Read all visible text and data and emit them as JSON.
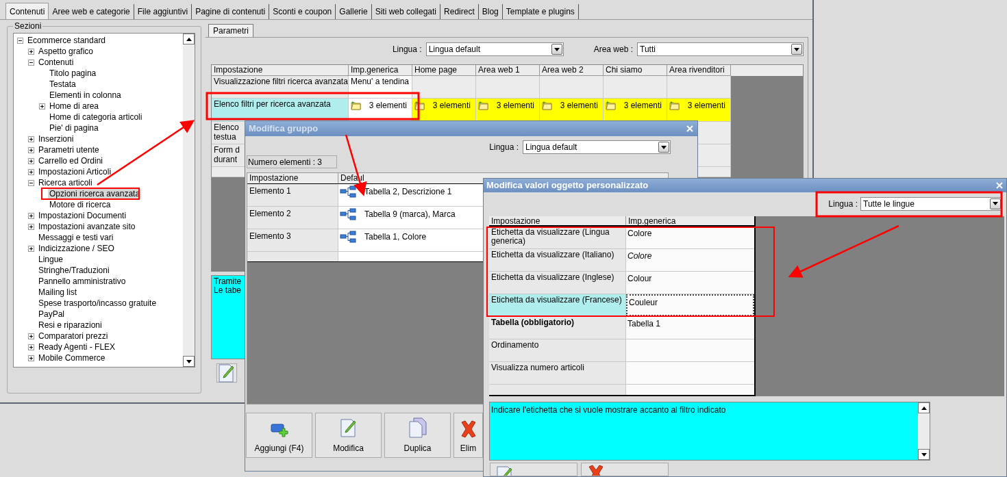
{
  "tabs": [
    {
      "label": "Contenuti",
      "selected": true
    },
    {
      "label": "Aree web e categorie",
      "selected": false
    },
    {
      "label": "File aggiuntivi",
      "selected": false
    },
    {
      "label": "Pagine di contenuti",
      "selected": false
    },
    {
      "label": "Sconti e coupon",
      "selected": false
    },
    {
      "label": "Gallerie",
      "selected": false
    },
    {
      "label": "Siti web collegati",
      "selected": false
    },
    {
      "label": "Redirect",
      "selected": false
    },
    {
      "label": "Blog",
      "selected": false
    },
    {
      "label": "Template e plugins",
      "selected": false
    }
  ],
  "sections": {
    "title": "Sezioni",
    "tree": [
      {
        "label": "Ecommerce standard",
        "kind": "group",
        "expanded": true,
        "selected": false,
        "children": [
          {
            "label": "Aspetto grafico",
            "kind": "group",
            "expanded": false,
            "selected": false
          },
          {
            "label": "Contenuti",
            "kind": "group",
            "expanded": true,
            "selected": false,
            "children": [
              {
                "label": "Titolo pagina",
                "kind": "leaf",
                "selected": false
              },
              {
                "label": "Testata",
                "kind": "leaf",
                "selected": false
              },
              {
                "label": "Elementi in colonna",
                "kind": "leaf",
                "selected": false
              },
              {
                "label": "Home di area",
                "kind": "group",
                "expanded": false,
                "selected": false
              },
              {
                "label": "Home di categoria articoli",
                "kind": "leaf",
                "selected": false
              },
              {
                "label": "Pie' di pagina",
                "kind": "leaf",
                "selected": false
              }
            ]
          },
          {
            "label": "Inserzioni",
            "kind": "group",
            "expanded": false,
            "selected": false
          },
          {
            "label": "Parametri utente",
            "kind": "group",
            "expanded": false,
            "selected": false
          },
          {
            "label": "Carrello ed Ordini",
            "kind": "group",
            "expanded": false,
            "selected": false
          },
          {
            "label": "Impostazioni Articoli",
            "kind": "group",
            "expanded": false,
            "selected": false
          },
          {
            "label": "Ricerca articoli",
            "kind": "group",
            "expanded": true,
            "selected": false,
            "children": [
              {
                "label": "Opzioni ricerca avanzata",
                "kind": "leaf",
                "selected": true
              },
              {
                "label": "Motore di ricerca",
                "kind": "leaf",
                "selected": false
              }
            ]
          },
          {
            "label": "Impostazioni Documenti",
            "kind": "group",
            "expanded": false,
            "selected": false
          },
          {
            "label": "Impostazioni avanzate sito",
            "kind": "group",
            "expanded": false,
            "selected": false
          },
          {
            "label": "Messaggi e testi vari",
            "kind": "leaf",
            "selected": false
          },
          {
            "label": "Indicizzazione / SEO",
            "kind": "group",
            "expanded": false,
            "selected": false
          },
          {
            "label": "Lingue",
            "kind": "leaf",
            "selected": false
          },
          {
            "label": "Stringhe/Traduzioni",
            "kind": "leaf",
            "selected": false
          },
          {
            "label": "Pannello amministrativo",
            "kind": "leaf",
            "selected": false
          },
          {
            "label": "Mailing list",
            "kind": "leaf",
            "selected": false
          },
          {
            "label": "Spese trasporto/incasso gratuite",
            "kind": "leaf",
            "selected": false
          },
          {
            "label": "PayPal",
            "kind": "leaf",
            "selected": false
          },
          {
            "label": "Resi e riparazioni",
            "kind": "leaf",
            "selected": false
          },
          {
            "label": "Comparatori prezzi",
            "kind": "group",
            "expanded": false,
            "selected": false
          },
          {
            "label": "Ready Agenti - FLEX",
            "kind": "group",
            "expanded": false,
            "selected": false
          },
          {
            "label": "Mobile Commerce",
            "kind": "group",
            "expanded": false,
            "selected": false
          }
        ]
      }
    ]
  },
  "params": {
    "tab": "Parametri",
    "lingua_label": "Lingua :",
    "lingua_value": "Lingua default",
    "area_label": "Area web :",
    "area_value": "Tutti",
    "columns": [
      "Impostazione",
      "Imp.generica",
      "Home page",
      "Area web 1",
      "Area web 2",
      "Chi siamo",
      "Area rivenditori"
    ],
    "rows": [
      {
        "selected": false,
        "cells": [
          {
            "kind": "text",
            "text": "Visualizzazione filtri ricerca avanzata",
            "overridden": false
          },
          {
            "kind": "text",
            "text": "Menu' a tendina",
            "overridden": false
          }
        ]
      },
      {
        "selected": true,
        "cells": [
          {
            "kind": "text",
            "text": "Elenco filtri per ricerca avanzata",
            "overridden": false
          },
          {
            "kind": "group",
            "text": "3 elementi",
            "overridden": false
          },
          {
            "kind": "group",
            "text": "3 elementi",
            "overridden": true
          },
          {
            "kind": "group",
            "text": "3 elementi",
            "overridden": true
          },
          {
            "kind": "group",
            "text": "3 elementi",
            "overridden": true
          },
          {
            "kind": "group",
            "text": "3 elementi",
            "overridden": true
          },
          {
            "kind": "group",
            "text": "3 elementi",
            "overridden": true
          }
        ]
      },
      {
        "selected": false,
        "cells": [
          {
            "kind": "text",
            "text": "Elenco\ntestua",
            "overridden": false
          }
        ]
      },
      {
        "selected": false,
        "cells": [
          {
            "kind": "text",
            "text": "Form d\ndurant",
            "overridden": false
          }
        ]
      }
    ],
    "description": "Tramite\nLe tabe"
  },
  "group_dialog": {
    "title": "Modifica gruppo",
    "lingua_label": "Lingua :",
    "lingua_value": "Lingua default",
    "count": "Numero elementi : 3",
    "columns": [
      "Impostazione",
      "Defaul"
    ],
    "rows": [
      {
        "label": "Elemento 1",
        "value": "Tabella 2, Descrizione 1"
      },
      {
        "label": "Elemento 2",
        "value": "Tabella 9 (marca), Marca"
      },
      {
        "label": "Elemento 3",
        "value": "Tabella 1, Colore"
      }
    ],
    "buttons": [
      {
        "kind": "add",
        "label": "Aggiungi (F4)"
      },
      {
        "kind": "edit",
        "label": "Modifica"
      },
      {
        "kind": "duplicate",
        "label": "Duplica"
      },
      {
        "kind": "delete",
        "label": "Elim"
      }
    ]
  },
  "values_dialog": {
    "title": "Modifica valori oggetto personalizzato",
    "lingua_label": "Lingua :",
    "lingua_value": "Tutte le lingue",
    "columns": [
      "Impostazione",
      "Imp.generica"
    ],
    "rows": [
      {
        "label": "Etichetta da visualizzare (Lingua generica)",
        "value": "Colore",
        "required": false,
        "inherited": false,
        "selected": false
      },
      {
        "label": "Etichetta da visualizzare (Italiano)",
        "value": "Colore",
        "required": false,
        "inherited": true,
        "selected": false
      },
      {
        "label": "Etichetta da visualizzare (Inglese)",
        "value": "Colour",
        "required": false,
        "inherited": false,
        "selected": false
      },
      {
        "label": "Etichetta da visualizzare (Francese)",
        "value": "Couleur",
        "required": false,
        "inherited": false,
        "selected": true
      },
      {
        "label": "Tabella (obbligatorio)",
        "value": "Tabella 1",
        "required": true,
        "inherited": false,
        "selected": false
      },
      {
        "label": "Ordinamento",
        "required": false,
        "selected": false
      },
      {
        "label": "Visualizza numero articoli",
        "required": false,
        "selected": false
      }
    ],
    "description": "Indicare l'etichetta che si vuole mostrare accanto al filtro indicato",
    "buttons": [
      {
        "kind": "edit"
      },
      {
        "kind": "delete"
      }
    ]
  }
}
